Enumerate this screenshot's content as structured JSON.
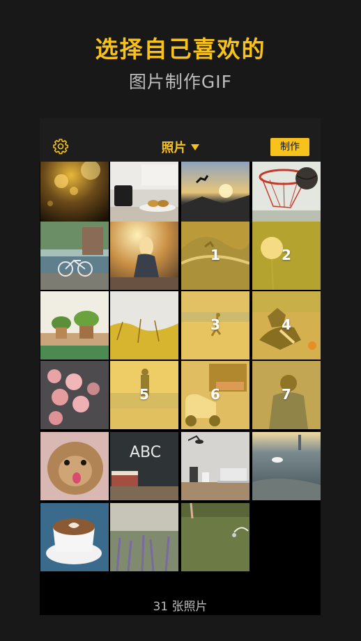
{
  "headline": "选择自己喜欢的",
  "subline": "图片制作GIF",
  "colors": {
    "accent": "#f6c21b",
    "background": "#181818",
    "panel": "#000000"
  },
  "topbar": {
    "settings_icon": "gear-icon",
    "album_title": "照片",
    "dropdown_icon": "triangle-down-icon",
    "make_label": "制作"
  },
  "photos": [
    {
      "subject": "bokeh lights rain glass",
      "selected": false,
      "number": ""
    },
    {
      "subject": "coffee mug and pillows",
      "selected": false,
      "number": ""
    },
    {
      "subject": "man jumping at sunset",
      "selected": false,
      "number": ""
    },
    {
      "subject": "basketball hoop",
      "selected": false,
      "number": ""
    },
    {
      "subject": "bicycle by canal",
      "selected": false,
      "number": ""
    },
    {
      "subject": "girl sitting in sunlight",
      "selected": false,
      "number": ""
    },
    {
      "subject": "surfer on wave",
      "selected": true,
      "number": "1"
    },
    {
      "subject": "dandelion",
      "selected": true,
      "number": "2"
    },
    {
      "subject": "potted herbs on windowsill",
      "selected": false,
      "number": ""
    },
    {
      "subject": "yellow flowering bush",
      "selected": false,
      "number": ""
    },
    {
      "subject": "kid running on beach",
      "selected": true,
      "number": "3"
    },
    {
      "subject": "dog on sand",
      "selected": true,
      "number": "4"
    },
    {
      "subject": "pink roses",
      "selected": false,
      "number": ""
    },
    {
      "subject": "person standing at sea",
      "selected": true,
      "number": "5"
    },
    {
      "subject": "scooter under window",
      "selected": true,
      "number": "6"
    },
    {
      "subject": "child from behind",
      "selected": true,
      "number": "7"
    },
    {
      "subject": "yorkshire terrier",
      "selected": false,
      "number": ""
    },
    {
      "subject": "chalkboard abc",
      "selected": false,
      "number": ""
    },
    {
      "subject": "desk with laptop and lamp",
      "selected": false,
      "number": ""
    },
    {
      "subject": "swans on lake",
      "selected": false,
      "number": ""
    },
    {
      "subject": "latte art cup",
      "selected": false,
      "number": ""
    },
    {
      "subject": "lavender field",
      "selected": false,
      "number": ""
    },
    {
      "subject": "lawn sprinkler",
      "selected": false,
      "number": ""
    }
  ],
  "chalkboard_text": "ABC",
  "footer_count": "31 张照片"
}
